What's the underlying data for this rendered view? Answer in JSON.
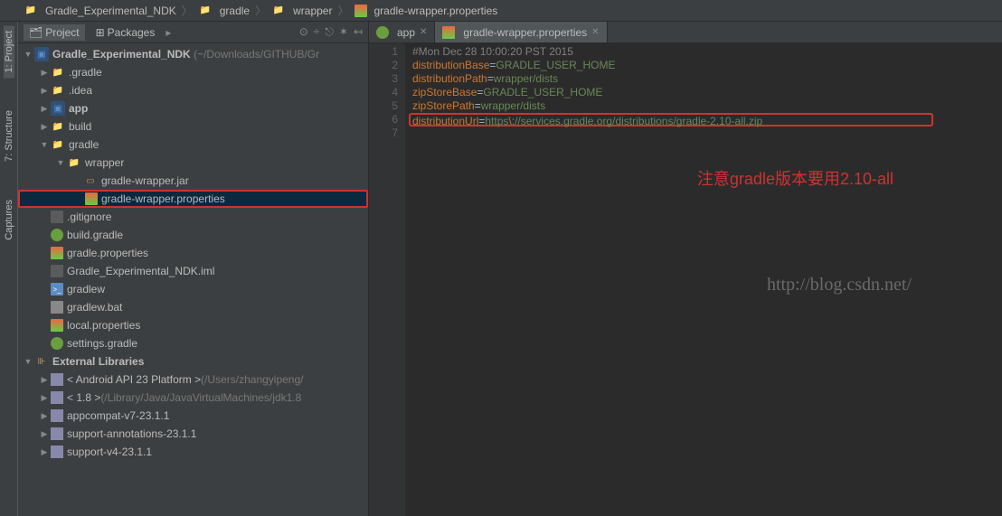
{
  "breadcrumb": [
    {
      "label": "Gradle_Experimental_NDK",
      "icon": "folder"
    },
    {
      "label": "gradle",
      "icon": "folder"
    },
    {
      "label": "wrapper",
      "icon": "folder"
    },
    {
      "label": "gradle-wrapper.properties",
      "icon": "props"
    }
  ],
  "left_rail": [
    {
      "label": "1: Project",
      "active": true
    },
    {
      "label": "7: Structure",
      "active": false
    },
    {
      "label": "Captures",
      "active": false
    }
  ],
  "panel": {
    "tabs": {
      "project": "Project",
      "packages": "Packages"
    },
    "active_tab": "project"
  },
  "tree": {
    "root": {
      "name": "Gradle_Experimental_NDK",
      "path": "(~/Downloads/GITHUB/Gr"
    },
    "items": [
      {
        "indent": 1,
        "arrow": "right",
        "icon": "folder",
        "label": ".gradle"
      },
      {
        "indent": 1,
        "arrow": "right",
        "icon": "folder",
        "label": ".idea"
      },
      {
        "indent": 1,
        "arrow": "right",
        "icon": "folder-app",
        "label": "app",
        "bold": true
      },
      {
        "indent": 1,
        "arrow": "right",
        "icon": "folder",
        "label": "build"
      },
      {
        "indent": 1,
        "arrow": "down",
        "icon": "folder",
        "label": "gradle"
      },
      {
        "indent": 2,
        "arrow": "down",
        "icon": "folder",
        "label": "wrapper"
      },
      {
        "indent": 3,
        "arrow": "none",
        "icon": "jar",
        "label": "gradle-wrapper.jar"
      },
      {
        "indent": 3,
        "arrow": "none",
        "icon": "props",
        "label": "gradle-wrapper.properties",
        "selected": true
      },
      {
        "indent": 1,
        "arrow": "none",
        "icon": "gray",
        "label": ".gitignore"
      },
      {
        "indent": 1,
        "arrow": "none",
        "icon": "gradle",
        "label": "build.gradle"
      },
      {
        "indent": 1,
        "arrow": "none",
        "icon": "props",
        "label": "gradle.properties"
      },
      {
        "indent": 1,
        "arrow": "none",
        "icon": "gray",
        "label": "Gradle_Experimental_NDK.iml"
      },
      {
        "indent": 1,
        "arrow": "none",
        "icon": "sh",
        "label": "gradlew"
      },
      {
        "indent": 1,
        "arrow": "none",
        "icon": "bat",
        "label": "gradlew.bat"
      },
      {
        "indent": 1,
        "arrow": "none",
        "icon": "props",
        "label": "local.properties"
      },
      {
        "indent": 1,
        "arrow": "none",
        "icon": "gradle",
        "label": "settings.gradle"
      }
    ],
    "ext_libs": {
      "label": "External Libraries",
      "items": [
        {
          "label": "< Android API 23 Platform >",
          "path": "(/Users/zhangyipeng/"
        },
        {
          "label": "< 1.8 >",
          "path": "(/Library/Java/JavaVirtualMachines/jdk1.8"
        },
        {
          "label": "appcompat-v7-23.1.1",
          "path": ""
        },
        {
          "label": "support-annotations-23.1.1",
          "path": ""
        },
        {
          "label": "support-v4-23.1.1",
          "path": ""
        }
      ]
    }
  },
  "editor": {
    "tabs": [
      {
        "label": "app",
        "icon": "gradle",
        "active": false
      },
      {
        "label": "gradle-wrapper.properties",
        "icon": "props",
        "active": true
      }
    ],
    "lines": [
      {
        "n": 1,
        "type": "comment",
        "text": "#Mon Dec 28 10:00:20 PST 2015"
      },
      {
        "n": 2,
        "key": "distributionBase",
        "val": "GRADLE_USER_HOME"
      },
      {
        "n": 3,
        "key": "distributionPath",
        "val": "wrapper/dists"
      },
      {
        "n": 4,
        "key": "zipStoreBase",
        "val": "GRADLE_USER_HOME"
      },
      {
        "n": 5,
        "key": "zipStorePath",
        "val": "wrapper/dists"
      },
      {
        "n": 6,
        "key": "distributionUrl",
        "val_pre": "https",
        "esc": "\\:",
        "val_post": "//services.gradle.org/distributions/gradle-2.10-all.zip",
        "boxed": true
      },
      {
        "n": 7,
        "type": "empty"
      }
    ]
  },
  "annotation": "注意gradle版本要用2.10-all",
  "watermark": "http://blog.csdn.net/"
}
